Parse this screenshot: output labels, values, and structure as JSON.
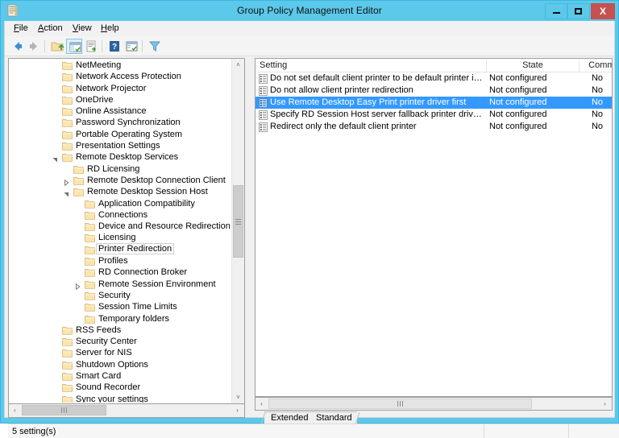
{
  "window": {
    "title": "Group Policy Management Editor",
    "icon": "console-document-icon",
    "caption_buttons": [
      {
        "name": "minimize-button",
        "label": "–"
      },
      {
        "name": "maximize-button",
        "label": "□"
      },
      {
        "name": "close-button",
        "label": "X"
      }
    ],
    "close_color": "#c75050",
    "titlebar_color": "#5cc8ea"
  },
  "menu": {
    "items": [
      {
        "label": "File",
        "accel": "F"
      },
      {
        "label": "Action",
        "accel": "A"
      },
      {
        "label": "View",
        "accel": "V"
      },
      {
        "label": "Help",
        "accel": "H"
      }
    ]
  },
  "toolbar": {
    "buttons": [
      {
        "name": "back-button",
        "icon": "arrow-left-icon",
        "enabled": true
      },
      {
        "name": "forward-button",
        "icon": "arrow-right-icon",
        "enabled": false
      },
      {
        "name": "up-one-level-button",
        "icon": "folder-up-icon",
        "enabled": true
      },
      {
        "name": "show-hide-console-tree-button",
        "icon": "console-tree-icon",
        "enabled": true,
        "active": true
      },
      {
        "name": "export-list-button",
        "icon": "export-list-icon",
        "enabled": true
      },
      {
        "name": "help-button",
        "icon": "question-mark-icon",
        "enabled": true
      },
      {
        "name": "properties-button",
        "icon": "properties-icon",
        "enabled": true
      },
      {
        "name": "filter-button",
        "icon": "funnel-filter-icon",
        "enabled": true
      }
    ]
  },
  "tree": {
    "scroll_position": "middle",
    "selected_node": "Printer Redirection",
    "nodes": [
      {
        "label": "NetMeeting",
        "depth": 2,
        "twisty": "none"
      },
      {
        "label": "Network Access Protection",
        "depth": 2,
        "twisty": "none"
      },
      {
        "label": "Network Projector",
        "depth": 2,
        "twisty": "none"
      },
      {
        "label": "OneDrive",
        "depth": 2,
        "twisty": "none"
      },
      {
        "label": "Online Assistance",
        "depth": 2,
        "twisty": "none"
      },
      {
        "label": "Password Synchronization",
        "depth": 2,
        "twisty": "none"
      },
      {
        "label": "Portable Operating System",
        "depth": 2,
        "twisty": "none"
      },
      {
        "label": "Presentation Settings",
        "depth": 2,
        "twisty": "none"
      },
      {
        "label": "Remote Desktop Services",
        "depth": 2,
        "twisty": "expanded"
      },
      {
        "label": "RD Licensing",
        "depth": 3,
        "twisty": "none"
      },
      {
        "label": "Remote Desktop Connection Client",
        "depth": 3,
        "twisty": "collapsed"
      },
      {
        "label": "Remote Desktop Session Host",
        "depth": 3,
        "twisty": "expanded"
      },
      {
        "label": "Application Compatibility",
        "depth": 4,
        "twisty": "none"
      },
      {
        "label": "Connections",
        "depth": 4,
        "twisty": "none"
      },
      {
        "label": "Device and Resource Redirection",
        "depth": 4,
        "twisty": "none"
      },
      {
        "label": "Licensing",
        "depth": 4,
        "twisty": "none"
      },
      {
        "label": "Printer Redirection",
        "depth": 4,
        "twisty": "none",
        "selected": true
      },
      {
        "label": "Profiles",
        "depth": 4,
        "twisty": "none"
      },
      {
        "label": "RD Connection Broker",
        "depth": 4,
        "twisty": "none"
      },
      {
        "label": "Remote Session Environment",
        "depth": 4,
        "twisty": "collapsed"
      },
      {
        "label": "Security",
        "depth": 4,
        "twisty": "none"
      },
      {
        "label": "Session Time Limits",
        "depth": 4,
        "twisty": "none"
      },
      {
        "label": "Temporary folders",
        "depth": 4,
        "twisty": "none"
      },
      {
        "label": "RSS Feeds",
        "depth": 2,
        "twisty": "none"
      },
      {
        "label": "Security Center",
        "depth": 2,
        "twisty": "none"
      },
      {
        "label": "Server for NIS",
        "depth": 2,
        "twisty": "none"
      },
      {
        "label": "Shutdown Options",
        "depth": 2,
        "twisty": "none"
      },
      {
        "label": "Smart Card",
        "depth": 2,
        "twisty": "none"
      },
      {
        "label": "Sound Recorder",
        "depth": 2,
        "twisty": "none"
      },
      {
        "label": "Sync your settings",
        "depth": 2,
        "twisty": "none"
      }
    ]
  },
  "list": {
    "columns": [
      {
        "label": "Setting",
        "key": "setting"
      },
      {
        "label": "State",
        "key": "state"
      },
      {
        "label": "Comment",
        "key": "comment"
      }
    ],
    "selection_color": "#3399ff",
    "rows": [
      {
        "setting": "Do not set default client printer to be default printer in a ses...",
        "state": "Not configured",
        "comment": "No",
        "selected": false
      },
      {
        "setting": "Do not allow client printer redirection",
        "state": "Not configured",
        "comment": "No",
        "selected": false
      },
      {
        "setting": "Use Remote Desktop Easy Print printer driver first",
        "state": "Not configured",
        "comment": "No",
        "selected": true
      },
      {
        "setting": "Specify RD Session Host server fallback printer driver behavior",
        "state": "Not configured",
        "comment": "No",
        "selected": false
      },
      {
        "setting": "Redirect only the default client printer",
        "state": "Not configured",
        "comment": "No",
        "selected": false
      }
    ]
  },
  "tabs": {
    "items": [
      {
        "label": "Extended",
        "selected": false
      },
      {
        "label": "Standard",
        "selected": true
      }
    ]
  },
  "statusbar": {
    "text": "5 setting(s)"
  },
  "scrollbars": {
    "left_up_arrow": "˄",
    "left_down_arrow": "˅",
    "left_arrow": "‹",
    "right_arrow": "›"
  }
}
